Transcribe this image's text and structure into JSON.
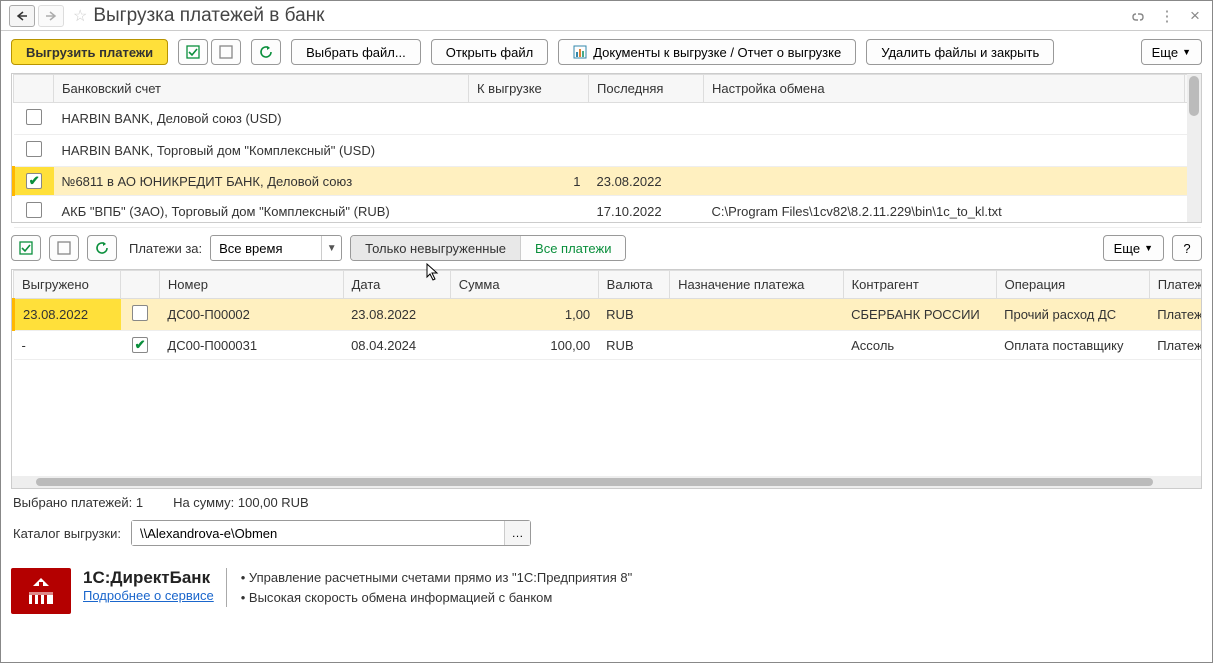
{
  "header": {
    "title": "Выгрузка платежей в банк"
  },
  "toolbar": {
    "export": "Выгрузить платежи",
    "select_file": "Выбрать файл...",
    "open_file": "Открыть файл",
    "docs_report": "Документы к выгрузке / Отчет о выгрузке",
    "delete_close": "Удалить файлы и закрыть",
    "more": "Еще"
  },
  "accounts_table": {
    "headers": {
      "account": "Банковский счет",
      "to_export": "К выгрузке",
      "last": "Последняя",
      "settings": "Настройка обмена"
    },
    "rows": [
      {
        "checked": false,
        "account": "HARBIN BANK, Деловой союз (USD)",
        "to_export": "",
        "last": "",
        "settings": ""
      },
      {
        "checked": false,
        "account": "HARBIN BANK, Торговый дом \"Комплексный\" (USD)",
        "to_export": "",
        "last": "",
        "settings": ""
      },
      {
        "checked": true,
        "account": "№6811 в АО ЮНИКРЕДИТ БАНК, Деловой союз",
        "to_export": "1",
        "last": "23.08.2022",
        "settings": ""
      },
      {
        "checked": false,
        "account": "АКБ \"ВПБ\" (ЗАО), Торговый дом \"Комплексный\" (RUB)",
        "to_export": "",
        "last": "17.10.2022",
        "settings": "C:\\Program Files\\1cv82\\8.2.11.229\\bin\\1c_to_kl.txt"
      }
    ]
  },
  "filter": {
    "label": "Платежи за:",
    "value": "Все время",
    "only_not_exported": "Только невыгруженные",
    "all_payments": "Все платежи",
    "more": "Еще",
    "help": "?"
  },
  "payments_table": {
    "headers": {
      "exported": "Выгружено",
      "chk": "",
      "number": "Номер",
      "date": "Дата",
      "sum": "Сумма",
      "currency": "Валюта",
      "purpose": "Назначение платежа",
      "counterparty": "Контрагент",
      "operation": "Операция",
      "doc": "Платежный"
    },
    "rows": [
      {
        "exported": "23.08.2022",
        "checked": false,
        "number": "ДС00-П00002",
        "date": "23.08.2022",
        "sum": "1,00",
        "currency": "RUB",
        "purpose": "",
        "counterparty": "СБЕРБАНК РОССИИ",
        "operation": "Прочий расход ДС",
        "doc": "Платежное"
      },
      {
        "exported": "-",
        "checked": true,
        "number": "ДС00-П000031",
        "date": "08.04.2024",
        "sum": "100,00",
        "currency": "RUB",
        "purpose": "",
        "counterparty": "Ассоль",
        "operation": "Оплата поставщику",
        "doc": "Платежное"
      }
    ]
  },
  "status": {
    "selected_label": "Выбрано платежей:",
    "selected_count": "1",
    "sum_label": "На сумму:",
    "sum_value": "100,00 RUB"
  },
  "directory": {
    "label": "Каталог выгрузки:",
    "value": "\\\\Alexandrova-e\\Obmen"
  },
  "promo": {
    "title": "1С:ДиректБанк",
    "link": "Подробнее о сервисе",
    "bullet1": "Управление расчетными счетами прямо из \"1С:Предприятия 8\"",
    "bullet2": "Высокая скорость обмена информацией с банком"
  }
}
